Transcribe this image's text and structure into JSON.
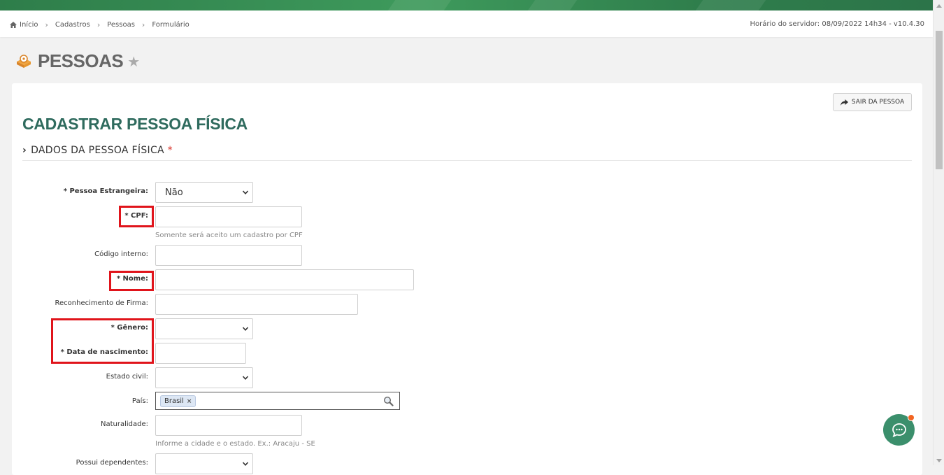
{
  "breadcrumb": {
    "items": [
      "Início",
      "Cadastros",
      "Pessoas",
      "Formulário"
    ]
  },
  "server_info": "Horário do servidor: 08/09/2022 14h34 - v10.4.30",
  "page": {
    "title": "PESSOAS"
  },
  "toolbar": {
    "exit_label": "SAIR DA PESSOA"
  },
  "form": {
    "title": "CADASTRAR PESSOA FÍSICA",
    "section_title": "DADOS DA PESSOA FÍSICA",
    "section_required": "*",
    "fields": {
      "estrangeira": {
        "label": "* Pessoa Estrangeira:",
        "value": "Não"
      },
      "cpf": {
        "label": "* CPF:",
        "value": "",
        "help": "Somente será aceito um cadastro por CPF"
      },
      "codigo": {
        "label": "Código interno:",
        "value": ""
      },
      "nome": {
        "label": "* Nome:",
        "value": ""
      },
      "firma": {
        "label": "Reconhecimento de Firma:",
        "value": ""
      },
      "genero": {
        "label": "* Gênero:",
        "value": ""
      },
      "nascimento": {
        "label": "* Data de nascimento:",
        "value": ""
      },
      "estado_civil": {
        "label": "Estado civil:",
        "value": ""
      },
      "pais": {
        "label": "País:",
        "tag": "Brasil",
        "tag_remove": "×"
      },
      "naturalidade": {
        "label": "Naturalidade:",
        "value": "",
        "help": "Informe a cidade e o estado. Ex.: Aracaju - SE"
      },
      "dependentes": {
        "label": "Possui dependentes:",
        "value": ""
      }
    }
  },
  "colors": {
    "accent": "#2f6b5e",
    "required": "#d9342b",
    "highlight": "#e0141b",
    "chat": "#3b8f6c",
    "notification": "#f26522"
  }
}
